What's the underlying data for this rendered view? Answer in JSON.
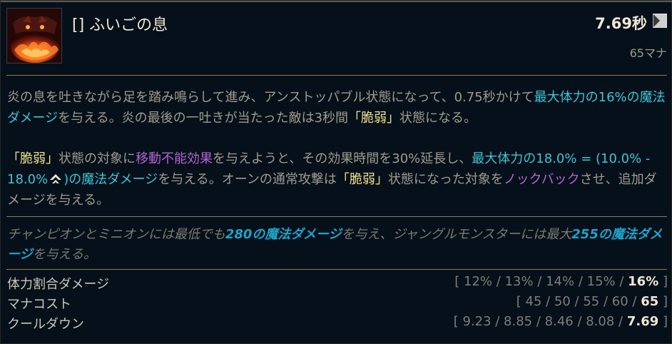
{
  "header": {
    "title": "[] ふいごの息",
    "cooldown": "7.69秒",
    "cost": "65マナ",
    "icon": "ornn-bellows-breath-icon"
  },
  "description": {
    "p1": [
      {
        "t": "炎の息を吐きながら足を踏み鳴らして進み、アンストッパブル状態になって、0.75秒かけて"
      },
      {
        "t": "最大体力の16%の魔法ダメージ",
        "c": "blue"
      },
      {
        "t": "を与える。炎の最後の一吐きが当たった敵は3秒間"
      },
      {
        "t": "「脆弱」",
        "c": "yellow"
      },
      {
        "t": "状態になる。"
      }
    ],
    "p2": [
      {
        "t": "「脆弱」",
        "c": "yellow"
      },
      {
        "t": "状態の対象に"
      },
      {
        "t": "移動不能効果",
        "c": "purple"
      },
      {
        "t": "を与えようと、その効果時間を30%延長し、"
      },
      {
        "t": "最大体力の18.0% = (10.0% - 18.0%",
        "c": "blue"
      },
      {
        "t": "[icon]",
        "c": "icon"
      },
      {
        "t": ")の魔法ダメージ",
        "c": "blue"
      },
      {
        "t": "を与える。オーンの通常攻撃は"
      },
      {
        "t": "「脆弱」",
        "c": "yellow"
      },
      {
        "t": "状態になった対象を"
      },
      {
        "t": "ノックバック",
        "c": "purple"
      },
      {
        "t": "させ、追加ダメージを与える。"
      }
    ],
    "p3": [
      {
        "t": "チャンピオンとミニオンには最低でも"
      },
      {
        "t": "280の魔法ダメージ",
        "c": "blue"
      },
      {
        "t": "を与え、ジャングルモンスターには最大"
      },
      {
        "t": "255の魔法ダメージ",
        "c": "blue"
      },
      {
        "t": "を与える。"
      }
    ]
  },
  "stats": [
    {
      "label": "体力割合ダメージ",
      "values": [
        "12%",
        "13%",
        "14%",
        "15%",
        "16%"
      ]
    },
    {
      "label": "マナコスト",
      "values": [
        "45",
        "50",
        "55",
        "60",
        "65"
      ]
    },
    {
      "label": "クールダウン",
      "values": [
        "9.23",
        "8.85",
        "8.46",
        "8.08",
        "7.69"
      ]
    }
  ],
  "colors": {
    "blue": "#3ec6d6",
    "purple": "#b264d3",
    "yellow": "#f0e08a",
    "divider": "#8b7a48",
    "background": "#06101a"
  },
  "icons": {
    "cooldown_icon": "cooldown-clock-icon",
    "scaling_icon": "level-scaling-icon"
  }
}
